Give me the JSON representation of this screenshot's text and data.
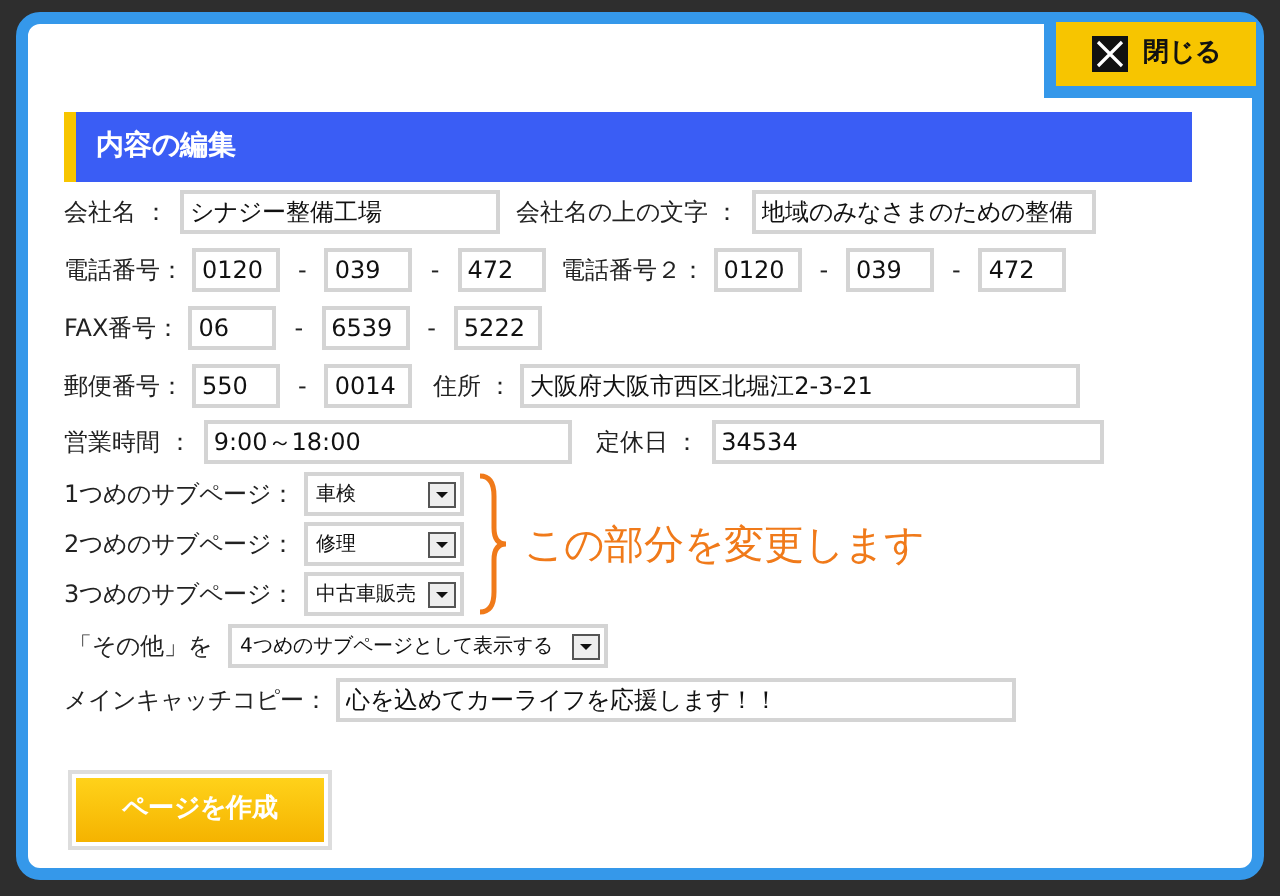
{
  "close_button": {
    "label": "閉じる"
  },
  "section_title": "内容の編集",
  "company": {
    "label": "会社名 ：",
    "value": "シナジー整備工場"
  },
  "tagline": {
    "label": "会社名の上の文字 ：",
    "value": "地域のみなさまのための整備"
  },
  "phone": {
    "label": "電話番号：",
    "parts": [
      {
        "kind": "field",
        "value": "0120"
      },
      {
        "kind": "dash",
        "text": "-"
      },
      {
        "kind": "field",
        "value": "039"
      },
      {
        "kind": "dash",
        "text": "-"
      },
      {
        "kind": "field",
        "value": "472"
      }
    ]
  },
  "phone2": {
    "label": "電話番号２：",
    "parts": [
      {
        "kind": "field",
        "value": "0120"
      },
      {
        "kind": "dash",
        "text": "-"
      },
      {
        "kind": "field",
        "value": "039"
      },
      {
        "kind": "dash",
        "text": "-"
      },
      {
        "kind": "field",
        "value": "472"
      }
    ]
  },
  "fax": {
    "label": "FAX番号：",
    "parts": [
      {
        "kind": "field",
        "value": "06"
      },
      {
        "kind": "dash",
        "text": "-"
      },
      {
        "kind": "field",
        "value": "6539"
      },
      {
        "kind": "dash",
        "text": "-"
      },
      {
        "kind": "field",
        "value": "5222"
      }
    ]
  },
  "postal": {
    "label": "郵便番号：",
    "parts": [
      {
        "kind": "field",
        "value": "550"
      },
      {
        "kind": "dash",
        "text": "-"
      },
      {
        "kind": "field",
        "value": "0014"
      }
    ]
  },
  "address": {
    "label": "住所 ：",
    "value": "大阪府大阪市西区北堀江2-3-21"
  },
  "hours": {
    "label": "営業時間 ：",
    "value": "9:00～18:00"
  },
  "holiday": {
    "label": "定休日 ：",
    "value": "34534"
  },
  "subpages": [
    {
      "label": "1つめのサブページ：",
      "value": "車検"
    },
    {
      "label": "2つめのサブページ：",
      "value": "修理"
    },
    {
      "label": "3つめのサブページ：",
      "value": "中古車販売"
    }
  ],
  "annotation": "この部分を変更します",
  "other": {
    "label": "「その他」を",
    "value": "4つめのサブページとして表示する"
  },
  "catchcopy": {
    "label": "メインキャッチコピー：",
    "value": "心を込めてカーライフを応援します！！"
  },
  "submit_button": {
    "label": "ページを作成"
  }
}
